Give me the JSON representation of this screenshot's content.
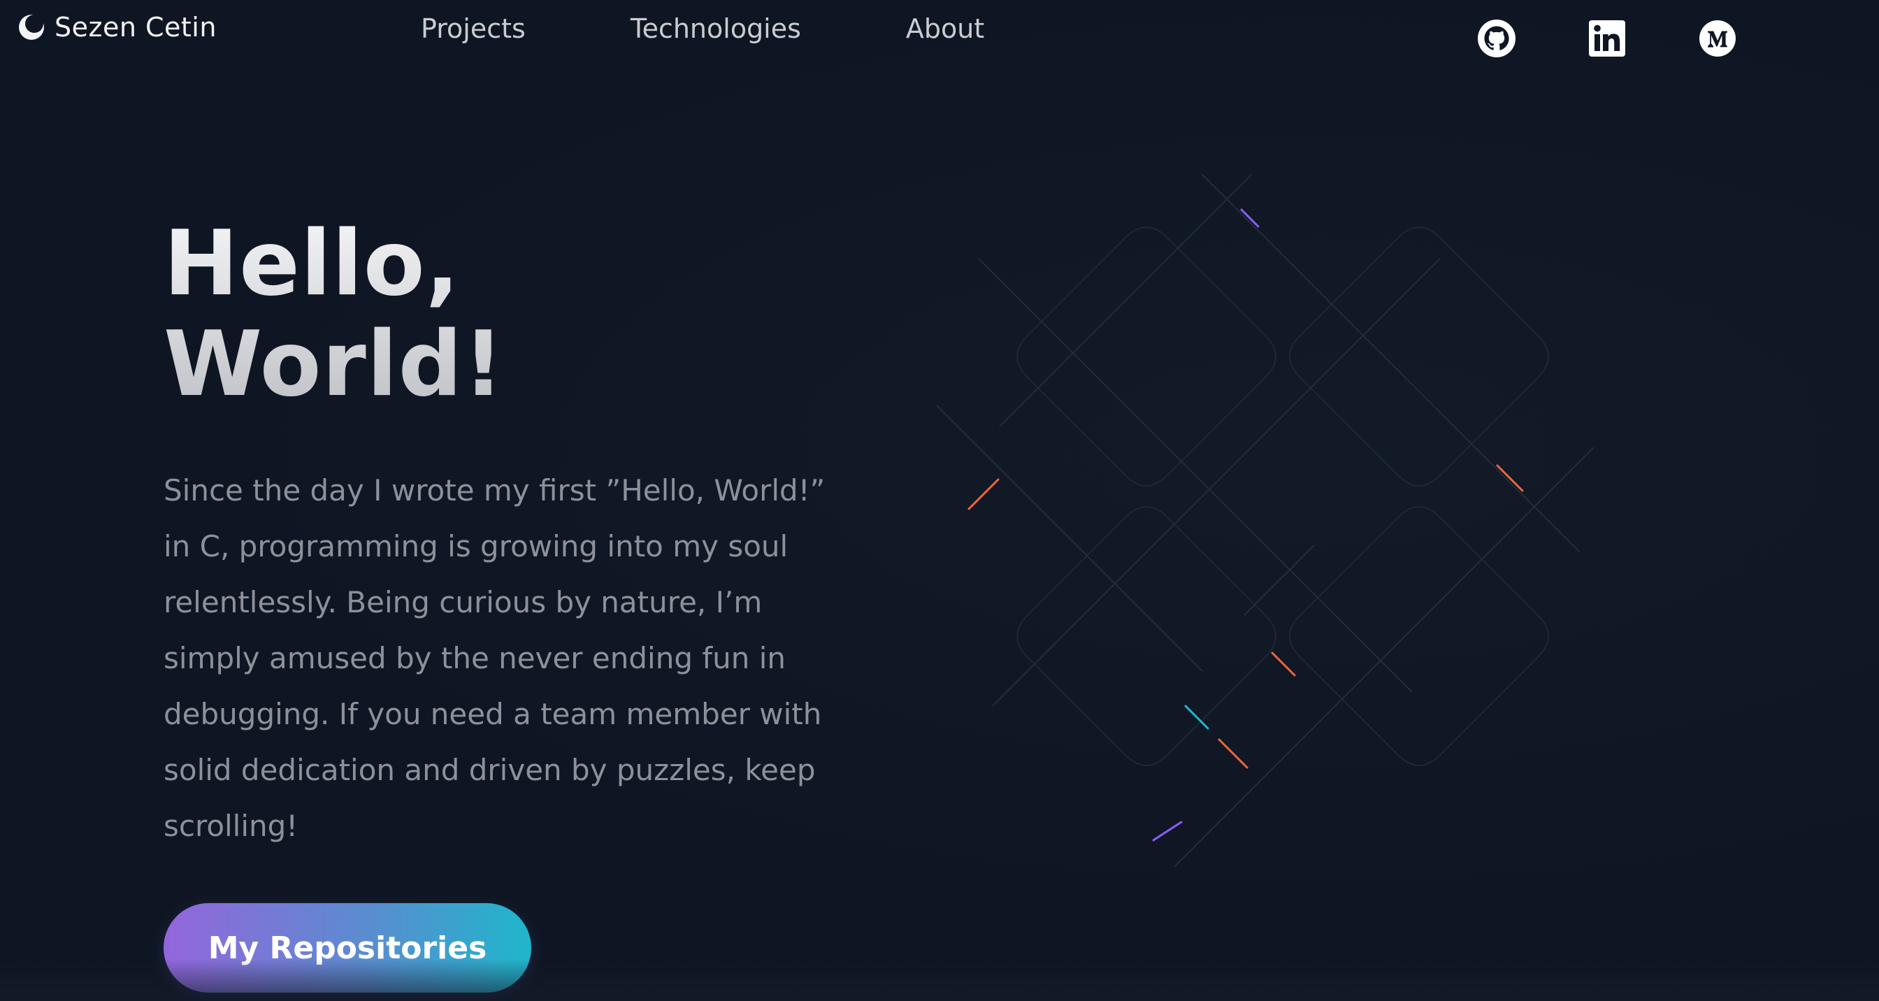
{
  "nav": {
    "logo_text": "Sezen Cetin",
    "logo_icon": "crescent-logo-icon",
    "links": [
      "Projects",
      "Technologies",
      "About"
    ],
    "social_icons": [
      "github-icon",
      "linkedin-icon",
      "medium-icon"
    ]
  },
  "hero": {
    "title_line1": "Hello,",
    "title_line2": "World!",
    "paragraph": "Since the day I wrote my first ”Hello, World!”\nin C, programming is growing into my soul\nrelentlessly. Being curious by nature, I’m\nsimply amused by the never ending fun in\ndebugging. If you need a team member with\nsolid dedication and driven by puzzles, keep\nscrolling!",
    "cta_label": "My Repositories"
  },
  "colors": {
    "background": "#0f1623",
    "nav_text": "#c9ccd2",
    "body_text": "#8d919a",
    "cta_gradient_start": "#9466dc",
    "cta_gradient_end": "#1fb6cb",
    "accent_orange": "#f0663a",
    "accent_purple": "#8b5cf6",
    "accent_cyan": "#22b8cf"
  }
}
